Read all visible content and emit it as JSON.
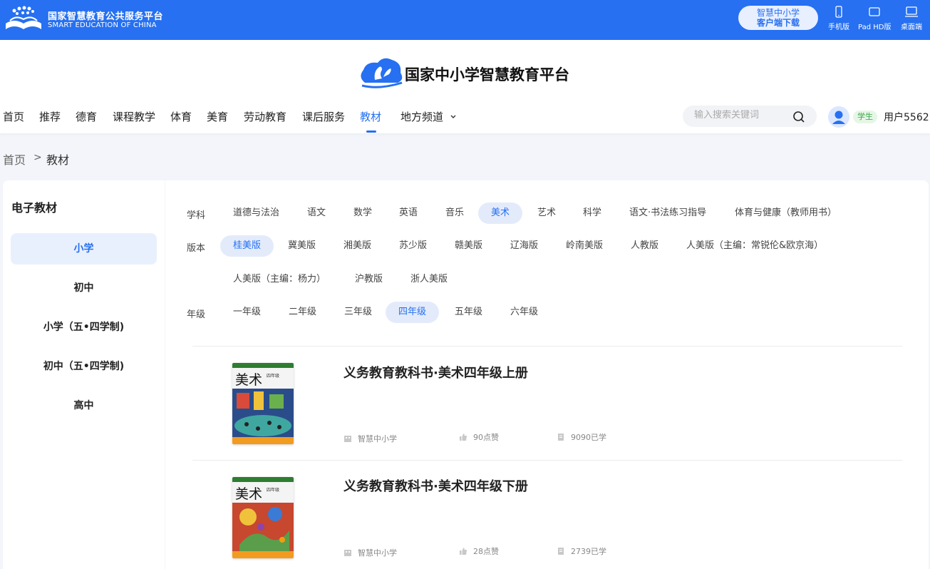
{
  "topbar": {
    "logo_cn": "国家智慧教育公共服务平台",
    "logo_en": "SMART EDUCATION OF CHINA",
    "download_line1": "智慧中小学",
    "download_line2": "客户端下载",
    "devices": [
      {
        "label": "手机版",
        "icon": "phone-icon"
      },
      {
        "label": "Pad HD版",
        "icon": "tablet-icon"
      },
      {
        "label": "桌面端",
        "icon": "desktop-icon"
      }
    ]
  },
  "header": {
    "brand_title": "国家中小学智慧教育平台",
    "nav": [
      "首页",
      "推荐",
      "德育",
      "课程教学",
      "体育",
      "美育",
      "劳动教育",
      "课后服务",
      "教材",
      "地方频道"
    ],
    "active_nav": "教材",
    "search_placeholder": "输入搜索关键词",
    "role_badge": "学生",
    "username": "用户5562"
  },
  "breadcrumb": {
    "home": "首页",
    "separator": ">",
    "current": "教材"
  },
  "left_panel": {
    "title": "电子教材",
    "levels": [
      "小学",
      "初中",
      "小学（五•四学制)",
      "初中（五•四学制)",
      "高中"
    ],
    "active_level": "小学"
  },
  "filters": {
    "subject_label": "学科",
    "subjects": [
      "道德与法治",
      "语文",
      "数学",
      "英语",
      "音乐",
      "美术",
      "艺术",
      "科学",
      "语文·书法练习指导",
      "体育与健康（教师用书）"
    ],
    "active_subject": "美术",
    "edition_label": "版本",
    "editions_row1": [
      "桂美版",
      "冀美版",
      "湘美版",
      "苏少版",
      "赣美版",
      "辽海版",
      "岭南美版",
      "人教版",
      "人美版（主编：常锐伦&欧京海）"
    ],
    "editions_row2": [
      "人美版（主编：杨力）",
      "沪教版",
      "浙人美版"
    ],
    "active_edition": "桂美版",
    "grade_label": "年级",
    "grades": [
      "一年级",
      "二年级",
      "三年级",
      "四年级",
      "五年级",
      "六年级"
    ],
    "active_grade": "四年级"
  },
  "books": [
    {
      "title": "义务教育教科书·美术四年级上册",
      "cover_text": "美术",
      "cover_sub": "四年级",
      "source": "智慧中小学",
      "likes": "90点赞",
      "learners": "9090已学",
      "colors": {
        "top": "#f0f0f0",
        "art": "#2b4c8a",
        "band": "#f29b21"
      }
    },
    {
      "title": "义务教育教科书·美术四年级下册",
      "cover_text": "美术",
      "cover_sub": "四年级",
      "source": "智慧中小学",
      "likes": "28点赞",
      "learners": "2739已学",
      "colors": {
        "top": "#f0f0f0",
        "art": "#c7472f",
        "band": "#f29b21"
      }
    }
  ],
  "colors": {
    "brand_blue": "#2670f1",
    "active_chip_bg": "#e3ebfb",
    "badge_green": "#3aa64a"
  }
}
